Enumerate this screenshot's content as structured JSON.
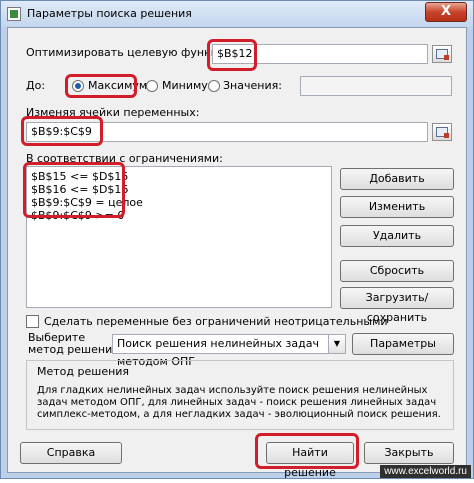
{
  "window": {
    "title": "Параметры поиска решения",
    "close_glyph": "X"
  },
  "objective": {
    "label": "Оптимизировать целевую функцию:",
    "value": "$B$12"
  },
  "to": {
    "label": "До:",
    "options": [
      {
        "label": "Максимум",
        "checked": true
      },
      {
        "label": "Минимум",
        "checked": false
      },
      {
        "label": "Значения:",
        "checked": false
      }
    ],
    "value_field": ""
  },
  "variables": {
    "label": "Изменяя ячейки переменных:",
    "value": "$B$9:$C$9"
  },
  "constraints": {
    "label": "В соответствии с ограничениями:",
    "items": [
      "$B$15 <= $D$15",
      "$B$16 <= $D$16",
      "$B$9:$C$9 = целое",
      "$B$9:$C$9 >= 0"
    ]
  },
  "side_buttons": {
    "add": "Добавить",
    "change": "Изменить",
    "delete": "Удалить",
    "reset": "Сбросить",
    "load_save": "Загрузить/сохранить"
  },
  "nonneg": {
    "label": "Сделать переменные без ограничений неотрицательными",
    "checked": false
  },
  "method": {
    "label_line1": "Выберите",
    "label_line2": "метод решения:",
    "selected": "Поиск решения нелинейных задач методом ОПГ",
    "params_button": "Параметры"
  },
  "method_group": {
    "title": "Метод решения",
    "description": "Для гладких нелинейных задач используйте поиск решения нелинейных задач методом ОПГ, для линейных задач - поиск решения линейных задач симплекс-методом, а для негладких задач - эволюционный поиск решения."
  },
  "bottom": {
    "help": "Справка",
    "solve": "Найти решение",
    "close": "Закрыть"
  },
  "watermark": "www.excelworld.ru",
  "colors": {
    "highlight": "#d21e2a",
    "title_gradient_top": "#dfeaf7",
    "dialog_bg": "#f0f0f0"
  }
}
